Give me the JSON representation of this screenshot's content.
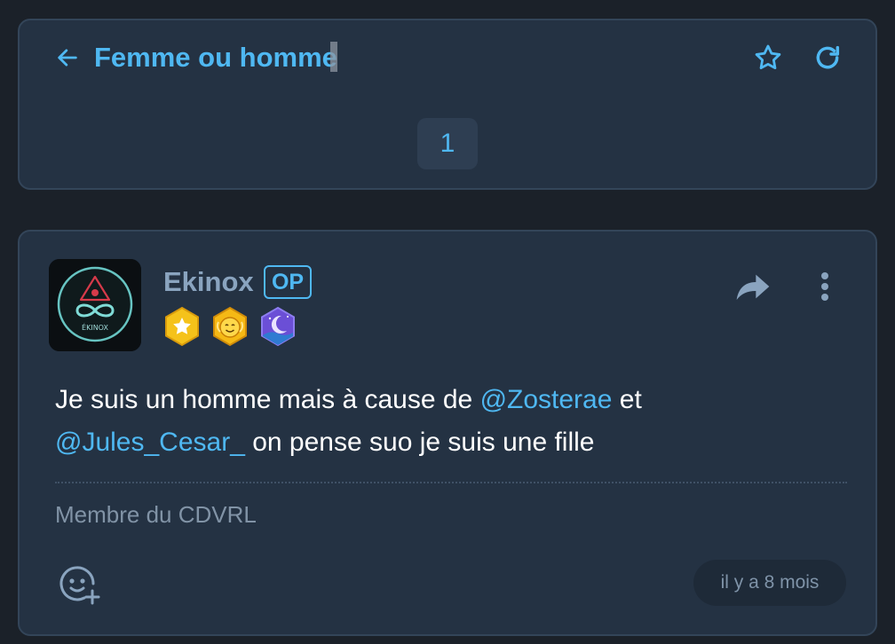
{
  "topic": {
    "title": "Femme ou homme",
    "current_page": "1"
  },
  "post": {
    "author": "Ekinox",
    "op_badge": "OP",
    "avatar_text": "ÉKINOX",
    "body": {
      "part1": "Je suis un homme mais à cause de ",
      "mention1": "@Zosterae",
      "part2": " et ",
      "mention2": "@Jules_Cesar_",
      "part3": " on pense suo je suis une fille"
    },
    "signature": "Membre du CDVRL",
    "timestamp": "il y a 8 mois"
  },
  "icons": {
    "back": "arrow-left-icon",
    "favorite": "star-outline-icon",
    "refresh": "refresh-icon",
    "share": "share-arrow-icon",
    "more": "more-vertical-icon",
    "reaction": "add-emoji-icon"
  },
  "colors": {
    "background": "#1b2129",
    "card": "#243243",
    "accent": "#4fb8f2",
    "author": "#8aa4bf",
    "muted": "#8193a6"
  }
}
